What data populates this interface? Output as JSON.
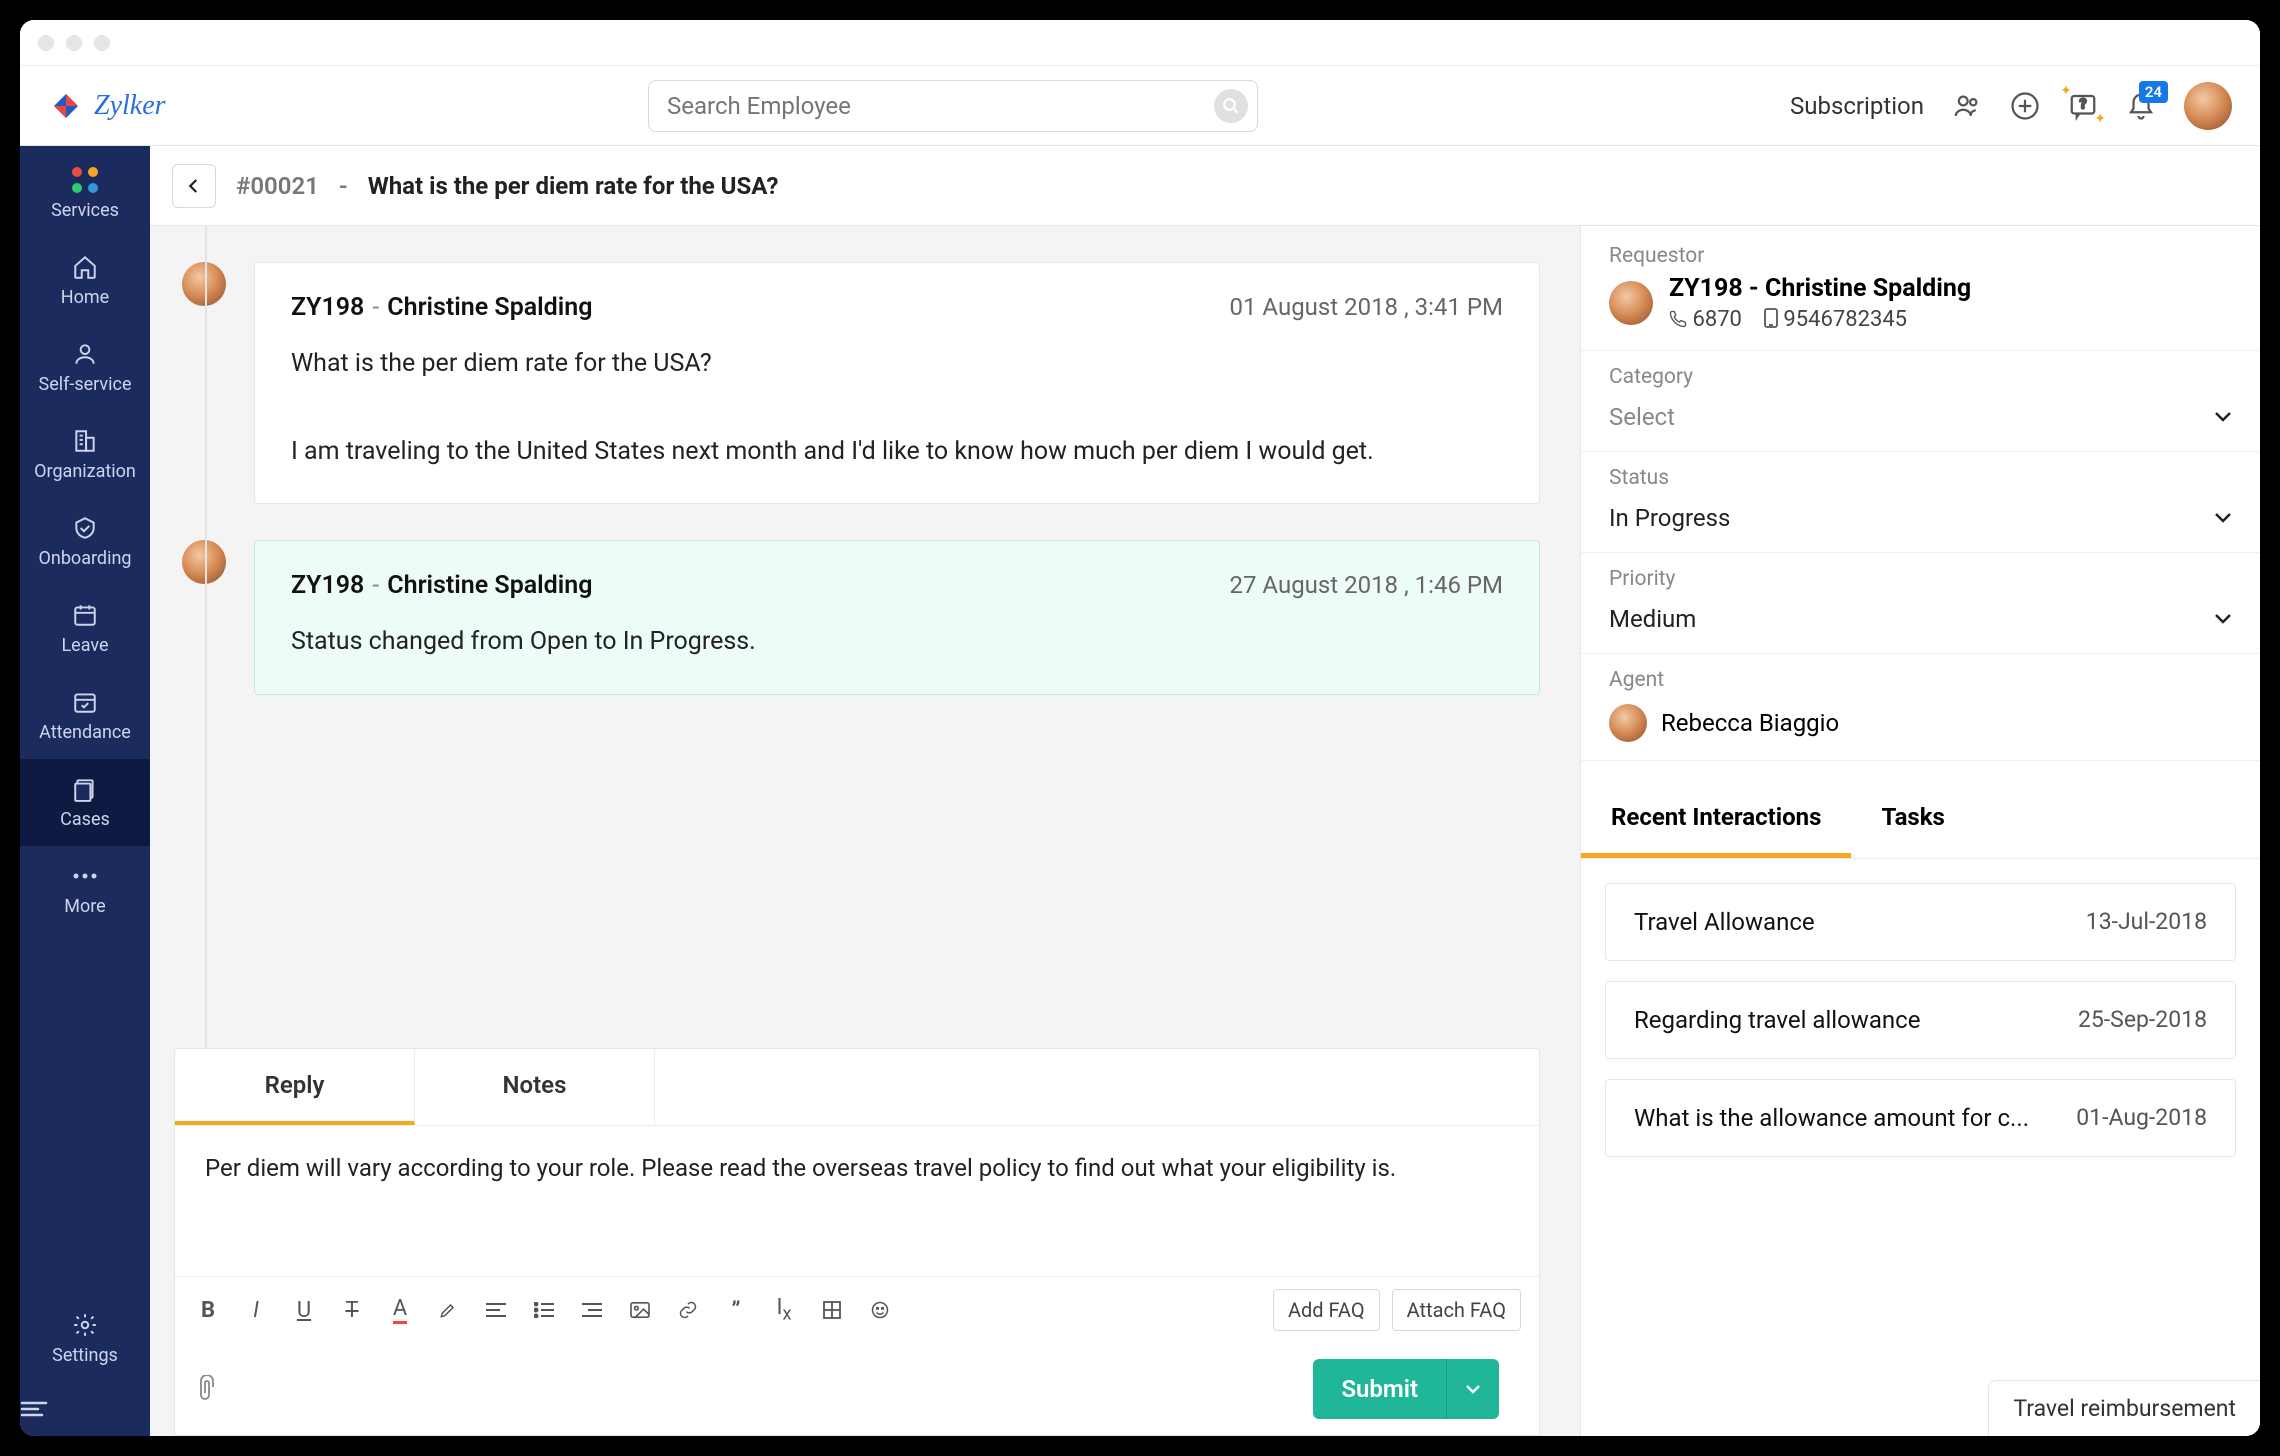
{
  "brand": "Zylker",
  "search_placeholder": "Search Employee",
  "subscription_label": "Subscription",
  "notif_count": "24",
  "sidebar": {
    "items": [
      {
        "label": "Services"
      },
      {
        "label": "Home"
      },
      {
        "label": "Self-service"
      },
      {
        "label": "Organization"
      },
      {
        "label": "Onboarding"
      },
      {
        "label": "Leave"
      },
      {
        "label": "Attendance"
      },
      {
        "label": "Cases"
      },
      {
        "label": "More"
      }
    ],
    "settings_label": "Settings"
  },
  "case": {
    "id": "#00021",
    "title": "What is the per diem rate for the USA?"
  },
  "messages": [
    {
      "from_id": "ZY198",
      "from_name": "Christine Spalding",
      "date": "01 August 2018 , 3:41 PM",
      "line1": "What is the per diem rate for the USA?",
      "line2": "I am traveling to the United States next month and I'd like to know how much per diem I would get."
    },
    {
      "from_id": "ZY198",
      "from_name": "Christine Spalding",
      "date": "27 August 2018 , 1:46 PM",
      "line1": "Status changed from Open to In Progress."
    }
  ],
  "reply": {
    "tabs": {
      "reply": "Reply",
      "notes": "Notes"
    },
    "draft": "Per diem will vary according to your role. Please read the overseas travel policy to find out what your eligibility is.",
    "add_faq": "Add FAQ",
    "attach_faq": "Attach FAQ",
    "submit": "Submit"
  },
  "details": {
    "requestor_label": "Requestor",
    "requestor_name": "ZY198 - Christine Spalding",
    "ext": "6870",
    "phone": "9546782345",
    "category_label": "Category",
    "category_value": "Select",
    "status_label": "Status",
    "status_value": "In Progress",
    "priority_label": "Priority",
    "priority_value": "Medium",
    "agent_label": "Agent",
    "agent_value": "Rebecca Biaggio"
  },
  "rtabs": {
    "recent": "Recent Interactions",
    "tasks": "Tasks"
  },
  "interactions": [
    {
      "title": "Travel Allowance",
      "date": "13-Jul-2018"
    },
    {
      "title": "Regarding travel allowance",
      "date": "25-Sep-2018"
    },
    {
      "title": "What is the allowance amount for c...",
      "date": "01-Aug-2018"
    }
  ],
  "float_chip": "Travel reimbursement"
}
